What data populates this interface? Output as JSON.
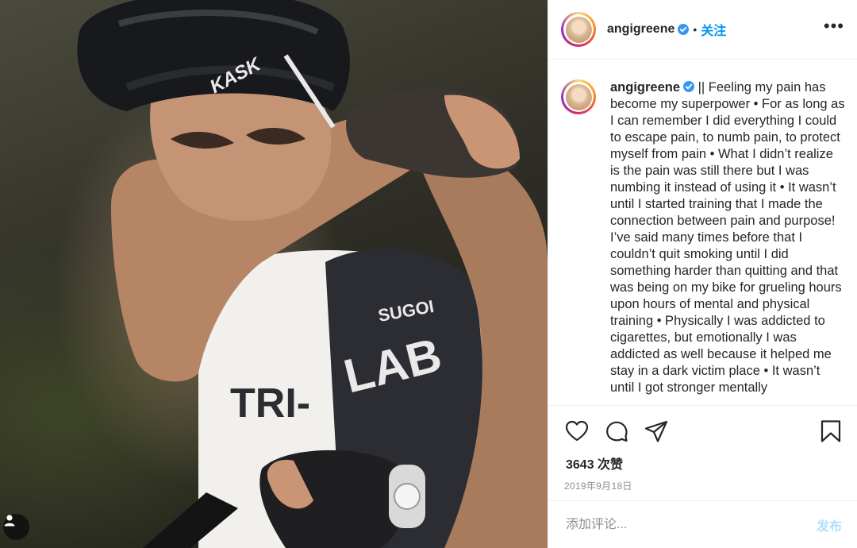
{
  "post": {
    "username": "angigreene",
    "follow_label": "关注",
    "dot": "•",
    "more_label": "•••",
    "caption": "|| Feeling my pain has become my superpower • For as long as I can remember I did everything I could to escape pain, to numb pain, to protect myself from pain • What I didn’t realize is the pain was still there but I was numbing it instead of using it • It wasn’t until I started training that I made the connection between pain and purpose! I’ve said many times before that I couldn’t quit smoking until I did something harder than quitting and that was being on my bike for grueling hours upon hours of mental and physical training • Physically I was addicted to cigarettes, but emotionally I was addicted as well because it helped me stay in a dark victim place • It wasn’t until I got stronger mentally",
    "likes": "3643 次赞",
    "date": "2019年9月18日",
    "comment_placeholder": "添加评论...",
    "post_label": "发布"
  },
  "photo": {
    "helmet_brand": "KASK",
    "jersey_brand": "SUGOI",
    "jersey_text_left": "TRI-",
    "jersey_text_right": "LAB"
  },
  "icons": {
    "like": "heart-icon",
    "comment": "comment-bubble-icon",
    "share": "paper-plane-icon",
    "save": "bookmark-icon",
    "verified": "verified-badge-icon",
    "user_tag": "user-icon"
  },
  "colors": {
    "accent": "#0095f6",
    "post_disabled": "#b2dffc",
    "muted": "#8e8e8e"
  }
}
